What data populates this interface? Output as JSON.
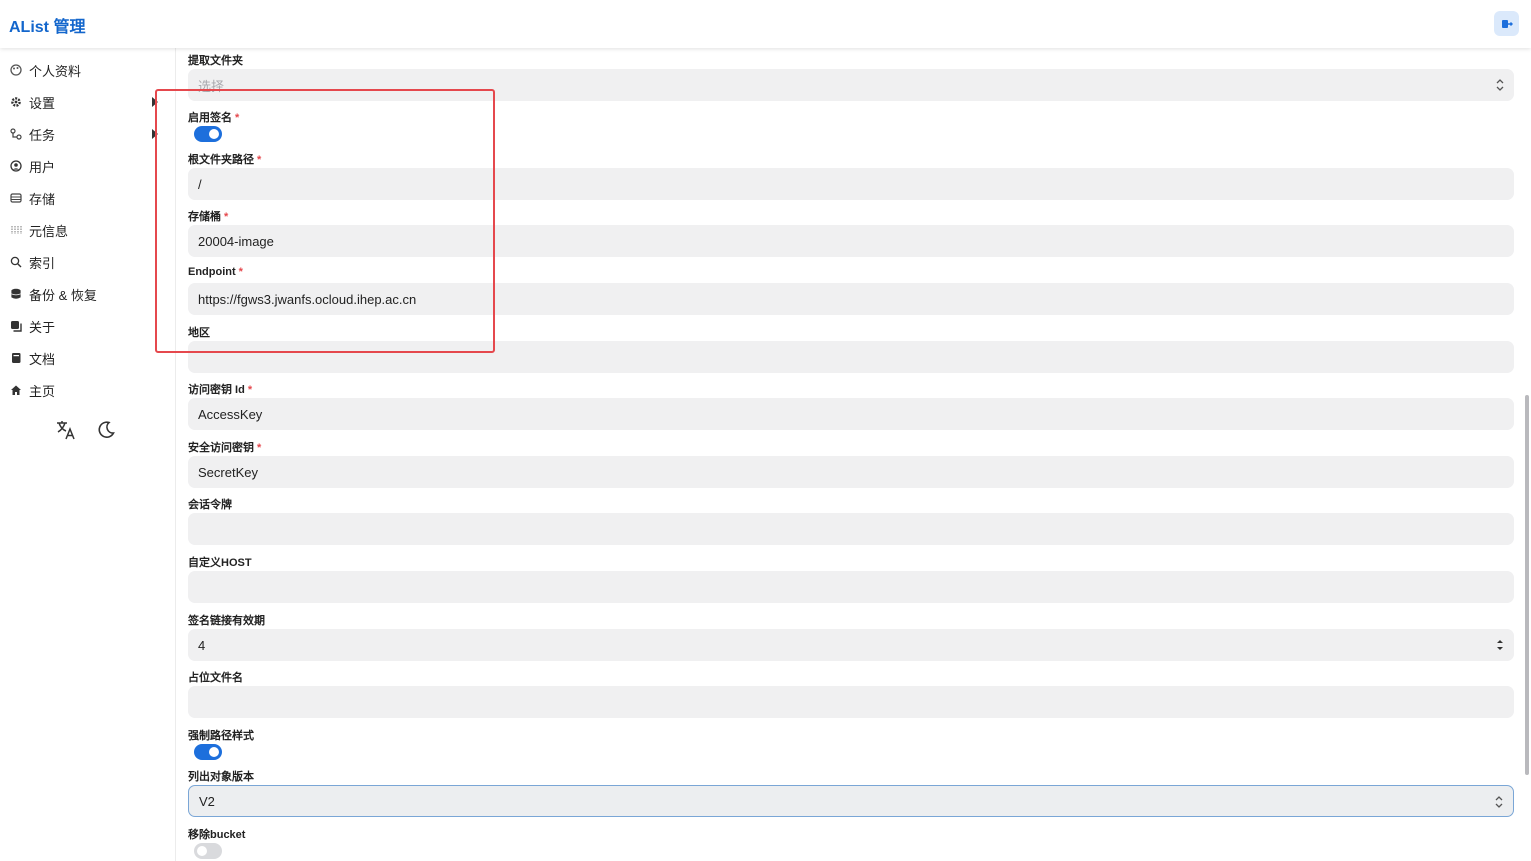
{
  "header": {
    "title": "AList 管理",
    "logout_icon": "logout-icon"
  },
  "sidebar": {
    "items": [
      {
        "label": "个人资料",
        "icon": "palette-icon"
      },
      {
        "label": "设置",
        "icon": "gear-icon",
        "expandable": true
      },
      {
        "label": "任务",
        "icon": "workflow-icon",
        "expandable": true
      },
      {
        "label": "用户",
        "icon": "user-icon"
      },
      {
        "label": "存储",
        "icon": "database-icon"
      },
      {
        "label": "元信息",
        "icon": "meta-icon"
      },
      {
        "label": "索引",
        "icon": "search-icon"
      },
      {
        "label": "备份 & 恢复",
        "icon": "backup-icon"
      },
      {
        "label": "关于",
        "icon": "copy-icon"
      },
      {
        "label": "文档",
        "icon": "book-icon"
      },
      {
        "label": "主页",
        "icon": "home-icon"
      }
    ],
    "tools": [
      "translate-icon",
      "moon-icon"
    ]
  },
  "form": {
    "extract_folder": {
      "label": "提取文件夹",
      "placeholder": "选择"
    },
    "enable_sign": {
      "label": "启用签名",
      "required": "*",
      "on": true
    },
    "root_folder_path": {
      "label": "根文件夹路径",
      "required": "*",
      "value": "/"
    },
    "bucket": {
      "label": "存储桶",
      "required": "*",
      "value": "20004-image"
    },
    "endpoint": {
      "label": "Endpoint",
      "required": "*",
      "value": "https://fgws3.jwanfs.ocloud.ihep.ac.cn"
    },
    "region": {
      "label": "地区",
      "value": ""
    },
    "access_key_id": {
      "label": "访问密钥 Id",
      "required": "*",
      "value": "AccessKey"
    },
    "secret_access_key": {
      "label": "安全访问密钥",
      "required": "*",
      "value": "SecretKey"
    },
    "session_token": {
      "label": "会话令牌",
      "value": ""
    },
    "custom_host": {
      "label": "自定义HOST",
      "value": ""
    },
    "sign_url_expire": {
      "label": "签名链接有效期",
      "value": "4"
    },
    "placeholder_file": {
      "label": "占位文件名",
      "value": ""
    },
    "force_path_style": {
      "label": "强制路径样式",
      "on": true
    },
    "list_object_version": {
      "label": "列出对象版本",
      "value": "V2"
    },
    "remove_bucket": {
      "label": "移除bucket",
      "on": false
    }
  },
  "colors": {
    "accent": "#1d6fdc",
    "brand": "#1366cc",
    "highlight_box": "#e5484d"
  }
}
